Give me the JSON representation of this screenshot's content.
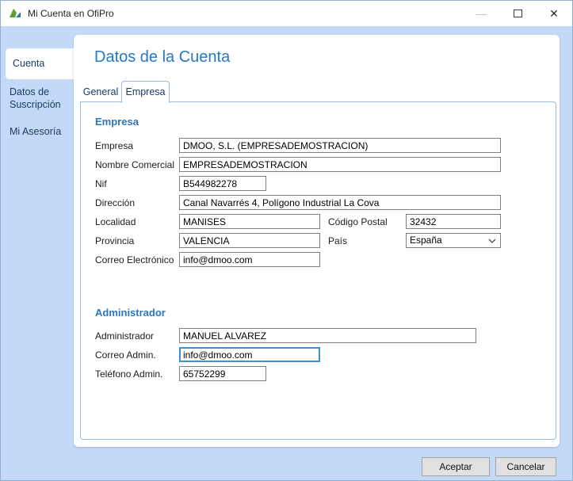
{
  "window": {
    "title": "Mi Cuenta en OfiPro"
  },
  "icons": {
    "app_logo": "ofipro-logo",
    "minimize": "minimize-icon",
    "maximize": "maximize-icon",
    "close": "close-icon",
    "pais_dropdown": "chevron-down-icon"
  },
  "sidebar": {
    "items": [
      {
        "label": "Cuenta",
        "selected": true
      },
      {
        "label": "Datos de Suscripción",
        "selected": false
      },
      {
        "label": "Mi Asesoría",
        "selected": false
      }
    ]
  },
  "main": {
    "heading": "Datos de la Cuenta",
    "tabs": [
      {
        "label": "General",
        "selected": false
      },
      {
        "label": "Empresa",
        "selected": true
      }
    ]
  },
  "form": {
    "empresa_section": {
      "title": "Empresa",
      "fields": {
        "empresa": {
          "label": "Empresa",
          "value": "DMOO, S.L. (EMPRESADEMOSTRACION)"
        },
        "nombre_comercial": {
          "label": "Nombre Comercial",
          "value": "EMPRESADEMOSTRACION"
        },
        "nif": {
          "label": "Nif",
          "value": "B544982278"
        },
        "direccion": {
          "label": "Dirección",
          "value": "Canal Navarrés 4, Polígono Industrial La Cova"
        },
        "localidad": {
          "label": "Localidad",
          "value": "MANISES"
        },
        "codigo_postal": {
          "label": "Código Postal",
          "value": "32432"
        },
        "provincia": {
          "label": "Provincia",
          "value": "VALENCIA"
        },
        "pais": {
          "label": "País",
          "value": "España"
        },
        "correo_electronico": {
          "label": "Correo Electrónico",
          "value": "info@dmoo.com"
        }
      }
    },
    "admin_section": {
      "title": "Administrador",
      "fields": {
        "administrador": {
          "label": "Administrador",
          "value": "MANUEL ALVAREZ"
        },
        "correo_admin": {
          "label": "Correo Admin.",
          "value": "info@dmoo.com",
          "focused": true
        },
        "telefono_admin": {
          "label": "Teléfono Admin.",
          "value": "65752299"
        }
      }
    }
  },
  "footer": {
    "accept": "Aceptar",
    "cancel": "Cancelar"
  },
  "colors": {
    "background_blue": "#c3d9f7",
    "heading_blue": "#2778c0",
    "section_title_blue": "#2e75b6",
    "nav_text_blue": "#1b3a66",
    "panel_border_blue": "#9cbce0",
    "input_border_gray": "#7f7f7f",
    "focus_border_blue": "#3d8fd6",
    "button_gray": "#e1e1e1"
  }
}
